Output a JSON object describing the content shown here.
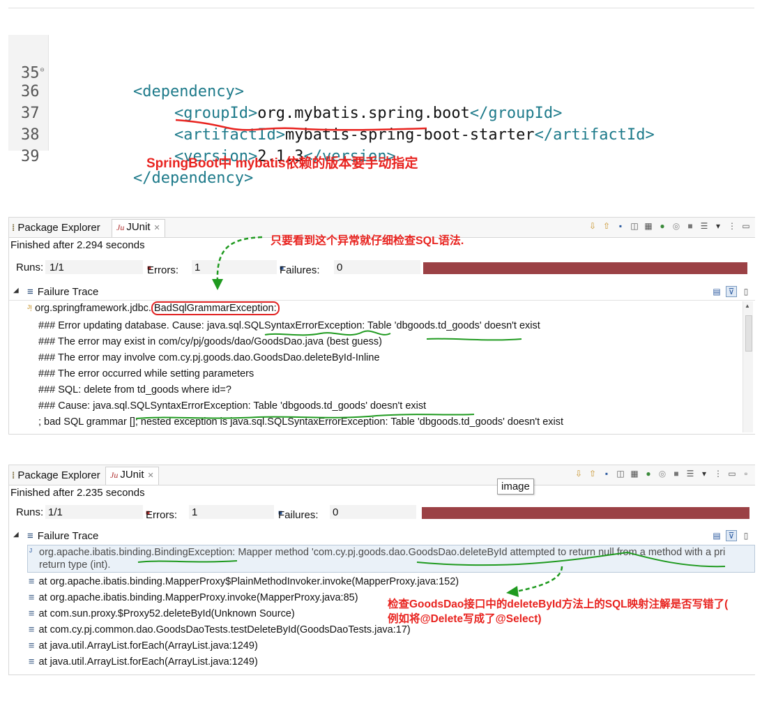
{
  "code": {
    "lines": [
      {
        "num": "35",
        "fold": "⊖",
        "text": "<dependency>"
      },
      {
        "num": "36",
        "open": "<groupId>",
        "value": "org.mybatis.spring.boot",
        "close": "</groupId>"
      },
      {
        "num": "37",
        "open": "<artifactId>",
        "value": "mybatis-spring-boot-starter",
        "close": "</artifactId>"
      },
      {
        "num": "38",
        "open": "<version>",
        "value": "2.1.3",
        "close": "</version>"
      },
      {
        "num": "39",
        "text": "</dependency>"
      }
    ],
    "annotation": "SpringBoot中 mybatis依赖的版本要手动指定"
  },
  "panel1": {
    "tabs": {
      "package_explorer": "Package Explorer",
      "junit": "JUnit"
    },
    "finished": "Finished after 2.294 seconds",
    "runs_label": "Runs:",
    "runs_value": "1/1",
    "errors_label": "Errors:",
    "errors_value": "1",
    "failures_label": "Failures:",
    "failures_value": "0",
    "failure_trace_label": "Failure Trace",
    "annotation": "只要看到这个异常就仔细检查SQL语法.",
    "trace_head_prefix": "org.springframework.jdbc.",
    "trace_head_exception": "BadSqlGrammarException:",
    "trace_lines": [
      "### Error updating database.  Cause: java.sql.SQLSyntaxErrorException: Table 'dbgoods.td_goods' doesn't exist",
      "### The error may exist in com/cy/pj/goods/dao/GoodsDao.java (best guess)",
      "### The error may involve com.cy.pj.goods.dao.GoodsDao.deleteById-Inline",
      "### The error occurred while setting parameters",
      "### SQL: delete from td_goods where id=?",
      "### Cause: java.sql.SQLSyntaxErrorException: Table 'dbgoods.td_goods' doesn't exist",
      "; bad SQL grammar []; nested exception is java.sql.SQLSyntaxErrorException: Table 'dbgoods.td_goods' doesn't exist"
    ]
  },
  "panel2": {
    "tabs": {
      "package_explorer": "Package Explorer",
      "junit": "JUnit"
    },
    "finished": "Finished after 2.235 seconds",
    "runs_label": "Runs:",
    "runs_value": "1/1",
    "errors_label": "Errors:",
    "errors_value": "1",
    "failures_label": "Failures:",
    "failures_value": "0",
    "failure_trace_label": "Failure Trace",
    "tooltip": "image",
    "first_line_a": "org.apache.ibatis.binding.BindingException: Mapper method 'com.cy.pj.goods.dao.GoodsDao.deleteById attempted to return null from a method with a pri",
    "first_line_b": "return type (int).",
    "stack": [
      "at org.apache.ibatis.binding.MapperProxy$PlainMethodInvoker.invoke(MapperProxy.java:152)",
      "at org.apache.ibatis.binding.MapperProxy.invoke(MapperProxy.java:85)",
      "at com.sun.proxy.$Proxy52.deleteById(Unknown Source)",
      "at com.cy.pj.common.dao.GoodsDaoTests.testDeleteById(GoodsDaoTests.java:17)",
      "at java.util.ArrayList.forEach(ArrayList.java:1249)",
      "at java.util.ArrayList.forEach(ArrayList.java:1249)"
    ],
    "annotation_line1": "检查GoodsDao接口中的deleteById方法上的SQL映射注解是否写错了(",
    "annotation_line2": "例如将@Delete写成了@Select)"
  },
  "colors": {
    "annotation_red": "#e8231f",
    "annotation_green": "#1f9a1f",
    "progress_failed": "#9b4145",
    "xml_tag": "#1d7a8a"
  },
  "progress": {
    "panel1_fraction": 1.0,
    "panel2_fraction": 1.0
  }
}
